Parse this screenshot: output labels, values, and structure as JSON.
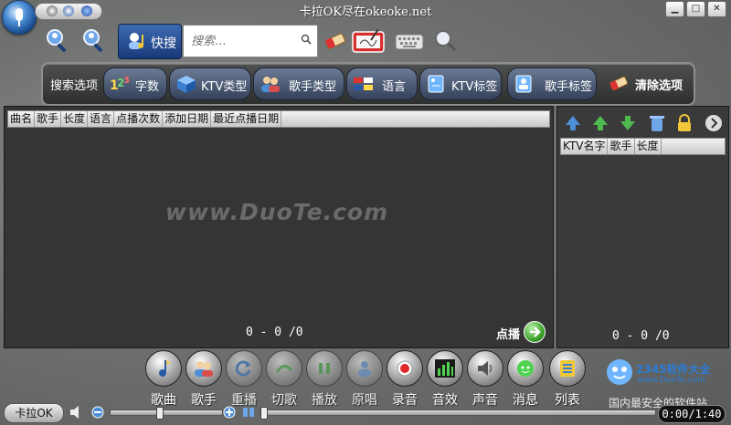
{
  "window": {
    "title": "卡拉OK尽在okeoke.net"
  },
  "toolbar": {
    "quick_search_label": "快搜",
    "search_placeholder": "搜索..."
  },
  "options": {
    "label": "搜索选项",
    "items": [
      {
        "label": "字数"
      },
      {
        "label": "KTV类型"
      },
      {
        "label": "歌手类型"
      },
      {
        "label": "语言"
      },
      {
        "label": "KTV标签"
      },
      {
        "label": "歌手标签"
      }
    ],
    "clear_label": "清除选项"
  },
  "song_list": {
    "columns": [
      "曲名",
      "歌手",
      "长度",
      "语言",
      "点播次数",
      "添加日期",
      "最近点播日期"
    ],
    "count": "0 - 0 /0",
    "play_label": "点播"
  },
  "playlist": {
    "columns": [
      "KTV名字",
      "歌手",
      "长度"
    ],
    "count": "0 - 0 /0"
  },
  "controls": [
    {
      "label": "歌曲",
      "enabled": true
    },
    {
      "label": "歌手",
      "enabled": true
    },
    {
      "label": "重播",
      "enabled": false
    },
    {
      "label": "切歌",
      "enabled": false
    },
    {
      "label": "播放",
      "enabled": false
    },
    {
      "label": "原唱",
      "enabled": false
    },
    {
      "label": "录音",
      "enabled": true
    },
    {
      "label": "音效",
      "enabled": true
    },
    {
      "label": "声音",
      "enabled": true
    },
    {
      "label": "消息",
      "enabled": true
    },
    {
      "label": "列表",
      "enabled": true
    }
  ],
  "status": {
    "karaoke_label": "卡拉OK",
    "time": "0:00/1:40"
  },
  "watermark": "www.DuoTe.com",
  "brand": {
    "line1": "2345软件大全",
    "line2": "www.DuoTe.com",
    "line3": "国内最安全的软件站"
  }
}
